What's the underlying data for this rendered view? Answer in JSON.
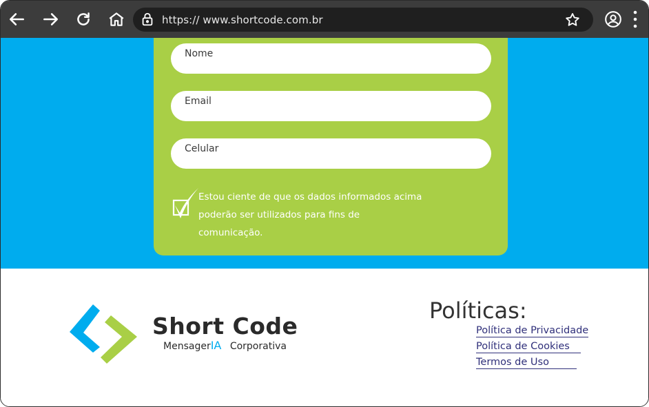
{
  "browser": {
    "url": "https:// www.shortcode.com.br",
    "icons": [
      "back-icon",
      "forward-icon",
      "reload-icon",
      "home-icon",
      "lock-icon",
      "star-icon",
      "profile-icon",
      "menu-icon"
    ]
  },
  "form": {
    "fields": [
      {
        "label": "Nome",
        "value": ""
      },
      {
        "label": "Email",
        "value": ""
      },
      {
        "label": "Celular",
        "value": ""
      }
    ],
    "consent": {
      "line1": "Estou ciente de que os dados informados acima",
      "line2": "poderão ser utilizados para fins de comunicação.",
      "checked": true
    }
  },
  "footer": {
    "brand": {
      "name": "Short Code",
      "sub_prefix": "Mensager",
      "sub_highlight": "IA",
      "sub_suffix": "Corporativa"
    },
    "policies": {
      "title": "Políticas:",
      "links": [
        "Política de Privacidade",
        "Política de Cookies",
        "Termos de Uso"
      ]
    }
  },
  "colors": {
    "chrome": "#3c3c3c",
    "address_bar": "#1f1f1f",
    "blue": "#00acee",
    "green": "#a9cf46",
    "link": "#2f2f7a"
  }
}
